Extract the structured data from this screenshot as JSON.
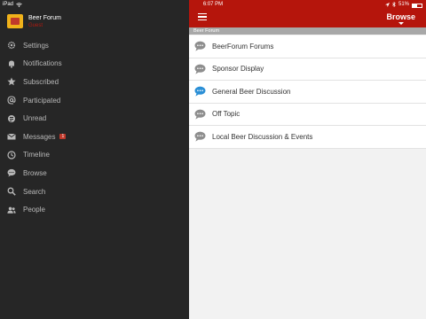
{
  "status_bar": {
    "device": "iPad",
    "time": "6:07 PM",
    "battery": "51%",
    "battery_level": 0.51
  },
  "sidebar": {
    "forum_name": "Beer Forum",
    "username": "Guest",
    "items": [
      {
        "label": "Settings",
        "icon": "gear-icon"
      },
      {
        "label": "Notifications",
        "icon": "bell-icon"
      },
      {
        "label": "Subscribed",
        "icon": "star-icon"
      },
      {
        "label": "Participated",
        "icon": "at-icon"
      },
      {
        "label": "Unread",
        "icon": "unread-icon"
      },
      {
        "label": "Messages",
        "icon": "envelope-icon",
        "badge": "1"
      },
      {
        "label": "Timeline",
        "icon": "timeline-icon"
      },
      {
        "label": "Browse",
        "icon": "browse-icon"
      },
      {
        "label": "Search",
        "icon": "search-icon"
      },
      {
        "label": "People",
        "icon": "people-icon"
      }
    ]
  },
  "main": {
    "browse_label": "Browse",
    "breadcrumb": "Beer Forum",
    "forums": [
      {
        "label": "BeerForum Forums",
        "status": "read"
      },
      {
        "label": "Sponsor Display",
        "status": "read"
      },
      {
        "label": "General Beer Discussion",
        "status": "unread"
      },
      {
        "label": "Off Topic",
        "status": "read"
      },
      {
        "label": "Local Beer Discussion & Events",
        "status": "read"
      }
    ]
  },
  "colors": {
    "accent": "#b5150c",
    "sidebar_bg": "#262626",
    "unread_icon": "#2b8fd6",
    "read_icon": "#8e8e8e"
  }
}
